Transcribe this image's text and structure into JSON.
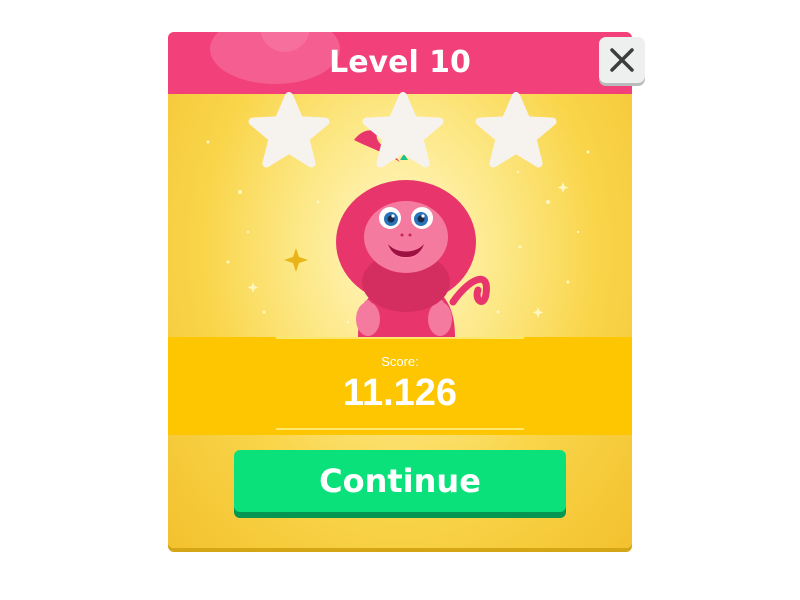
{
  "dialog": {
    "title": "Level 10",
    "stars_earned": 0,
    "stars_total": 3,
    "score_label": "Score:",
    "score_value": "11.126",
    "continue_label": "Continue",
    "close_icon": "close-icon"
  },
  "colors": {
    "header": "#f2407a",
    "panel": "#f9d54a",
    "score_band": "#fdc600",
    "button": "#0be17a",
    "button_shadow": "#079652",
    "star_empty": "#f4f1ec",
    "mascot": "#e8366c"
  },
  "icons": [
    "close-icon",
    "star-icon",
    "monkey-mascot-icon",
    "sparkle-icon"
  ]
}
